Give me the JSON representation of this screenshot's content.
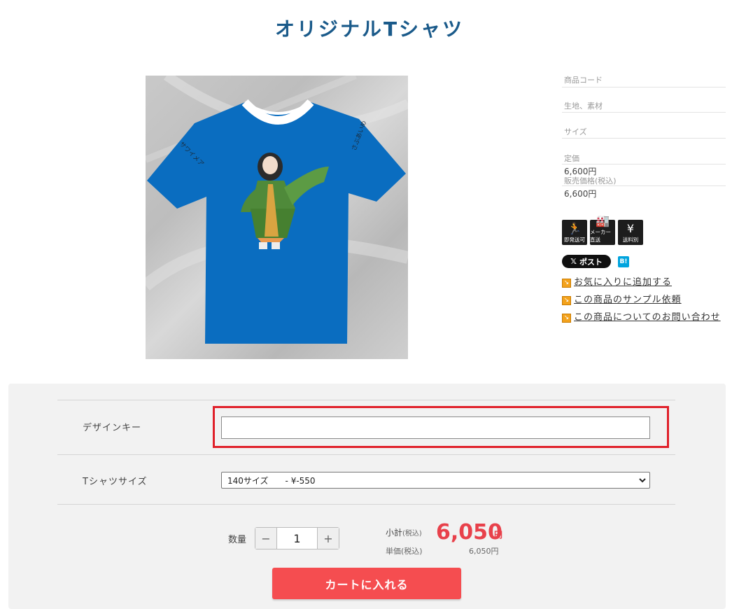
{
  "page": {
    "title": "オリジナルTシャツ"
  },
  "product": {
    "image_alt": "Blue T-shirt with character print",
    "sleeve_text_left": "サワイメア",
    "sleeve_text_right": "さぶあいめ"
  },
  "specs": {
    "code_label": "商品コード",
    "material_label": "生地、素材",
    "size_label": "サイズ",
    "list_price_label": "定価",
    "list_price": "6,600円",
    "sale_price_label": "販売価格(税込)",
    "sale_price": "6,600円"
  },
  "badges": [
    {
      "icon": "runner-icon",
      "label": "即発送可"
    },
    {
      "icon": "factory-icon",
      "label": "メーカー直送"
    },
    {
      "icon": "yen-truck-icon",
      "label": "送料別"
    }
  ],
  "share": {
    "x_label": "ポスト",
    "hatena_label": "B!"
  },
  "links": {
    "favorite": "お気に入りに追加する",
    "sample": "この商品のサンプル依頼",
    "inquiry": "この商品についてのお問い合わせ"
  },
  "form": {
    "design_key_label": "デザインキー",
    "design_key_value": "",
    "tshirt_size_label": "Tシャツサイズ",
    "tshirt_size_selected": "140サイズ　　- ¥-550",
    "qty_label": "数量",
    "qty_minus": "−",
    "qty_plus": "+",
    "qty_value": "1",
    "subtotal_label": "小計",
    "tax_incl": "(税込)",
    "subtotal_value": "6,050",
    "yen": "円",
    "unit_label": "単価",
    "unit_value": "6,050円",
    "cart_button": "カートに入れる"
  },
  "colors": {
    "title": "#1a5a8a",
    "shirt": "#0a6dc0",
    "accent_red": "#e8414b",
    "cart_button": "#f54d50",
    "highlight": "#e0202a"
  }
}
